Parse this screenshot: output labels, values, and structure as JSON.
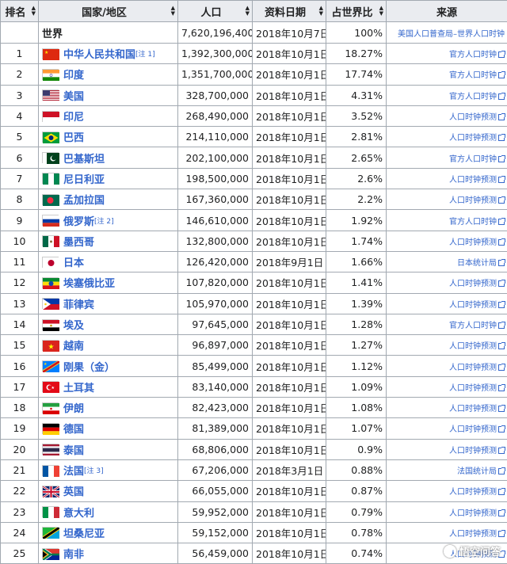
{
  "headers": {
    "rank": "排名",
    "country": "国家/地区",
    "population": "人口",
    "date": "资料日期",
    "share": "占世界比",
    "source": "来源"
  },
  "world": {
    "name": "世界",
    "population": "7,620,196,400",
    "date": "2018年10月7日",
    "share": "100%",
    "source": "美国人口普查局–世界人口时钟"
  },
  "rows": [
    {
      "rank": "1",
      "name": "中华人民共和国",
      "note": "[注 1]",
      "flag": "cn",
      "population": "1,392,300,000",
      "date": "2018年10月1日",
      "share": "18.27%",
      "source": "官方人口时钟"
    },
    {
      "rank": "2",
      "name": "印度",
      "note": "",
      "flag": "in",
      "population": "1,351,700,000",
      "date": "2018年10月1日",
      "share": "17.74%",
      "source": "官方人口时钟"
    },
    {
      "rank": "3",
      "name": "美国",
      "note": "",
      "flag": "us",
      "population": "328,700,000",
      "date": "2018年10月1日",
      "share": "4.31%",
      "source": "官方人口时钟"
    },
    {
      "rank": "4",
      "name": "印尼",
      "note": "",
      "flag": "id",
      "population": "268,490,000",
      "date": "2018年10月1日",
      "share": "3.52%",
      "source": "人口时钟预测"
    },
    {
      "rank": "5",
      "name": "巴西",
      "note": "",
      "flag": "br",
      "population": "214,110,000",
      "date": "2018年10月1日",
      "share": "2.81%",
      "source": "人口时钟预测"
    },
    {
      "rank": "6",
      "name": "巴基斯坦",
      "note": "",
      "flag": "pk",
      "population": "202,100,000",
      "date": "2018年10月1日",
      "share": "2.65%",
      "source": "官方人口时钟"
    },
    {
      "rank": "7",
      "name": "尼日利亚",
      "note": "",
      "flag": "ng",
      "population": "198,500,000",
      "date": "2018年10月1日",
      "share": "2.6%",
      "source": "人口时钟预测"
    },
    {
      "rank": "8",
      "name": "孟加拉国",
      "note": "",
      "flag": "bd",
      "population": "167,360,000",
      "date": "2018年10月1日",
      "share": "2.2%",
      "source": "人口时钟预测"
    },
    {
      "rank": "9",
      "name": "俄罗斯",
      "note": "[注 2]",
      "flag": "ru",
      "population": "146,610,000",
      "date": "2018年10月1日",
      "share": "1.92%",
      "source": "官方人口时钟"
    },
    {
      "rank": "10",
      "name": "墨西哥",
      "note": "",
      "flag": "mx",
      "population": "132,800,000",
      "date": "2018年10月1日",
      "share": "1.74%",
      "source": "人口时钟预测"
    },
    {
      "rank": "11",
      "name": "日本",
      "note": "",
      "flag": "jp",
      "population": "126,420,000",
      "date": "2018年9月1日",
      "share": "1.66%",
      "source": "日本统计局"
    },
    {
      "rank": "12",
      "name": "埃塞俄比亚",
      "note": "",
      "flag": "et",
      "population": "107,820,000",
      "date": "2018年10月1日",
      "share": "1.41%",
      "source": "人口时钟预测"
    },
    {
      "rank": "13",
      "name": "菲律宾",
      "note": "",
      "flag": "ph",
      "population": "105,970,000",
      "date": "2018年10月1日",
      "share": "1.39%",
      "source": "人口时钟预测"
    },
    {
      "rank": "14",
      "name": "埃及",
      "note": "",
      "flag": "eg",
      "population": "97,645,000",
      "date": "2018年10月1日",
      "share": "1.28%",
      "source": "官方人口时钟"
    },
    {
      "rank": "15",
      "name": "越南",
      "note": "",
      "flag": "vn",
      "population": "96,897,000",
      "date": "2018年10月1日",
      "share": "1.27%",
      "source": "人口时钟预测"
    },
    {
      "rank": "16",
      "name": "刚果（金）",
      "note": "",
      "flag": "cd",
      "population": "85,499,000",
      "date": "2018年10月1日",
      "share": "1.12%",
      "source": "人口时钟预测"
    },
    {
      "rank": "17",
      "name": "土耳其",
      "note": "",
      "flag": "tr",
      "population": "83,140,000",
      "date": "2018年10月1日",
      "share": "1.09%",
      "source": "人口时钟预测"
    },
    {
      "rank": "18",
      "name": "伊朗",
      "note": "",
      "flag": "ir",
      "population": "82,423,000",
      "date": "2018年10月1日",
      "share": "1.08%",
      "source": "人口时钟预测"
    },
    {
      "rank": "19",
      "name": "德国",
      "note": "",
      "flag": "de",
      "population": "81,389,000",
      "date": "2018年10月1日",
      "share": "1.07%",
      "source": "人口时钟预测"
    },
    {
      "rank": "20",
      "name": "泰国",
      "note": "",
      "flag": "th",
      "population": "68,806,000",
      "date": "2018年10月1日",
      "share": "0.9%",
      "source": "人口时钟预测"
    },
    {
      "rank": "21",
      "name": "法国",
      "note": "[注 3]",
      "flag": "fr",
      "population": "67,206,000",
      "date": "2018年3月1日",
      "share": "0.88%",
      "source": "法国统计局"
    },
    {
      "rank": "22",
      "name": "英国",
      "note": "",
      "flag": "gb",
      "population": "66,055,000",
      "date": "2018年10月1日",
      "share": "0.87%",
      "source": "人口时钟预测"
    },
    {
      "rank": "23",
      "name": "意大利",
      "note": "",
      "flag": "it",
      "population": "59,952,000",
      "date": "2018年10月1日",
      "share": "0.79%",
      "source": "人口时钟预测"
    },
    {
      "rank": "24",
      "name": "坦桑尼亚",
      "note": "",
      "flag": "tz",
      "population": "59,152,000",
      "date": "2018年10月1日",
      "share": "0.78%",
      "source": "人口时钟预测"
    },
    {
      "rank": "25",
      "name": "南非",
      "note": "",
      "flag": "za",
      "population": "56,459,000",
      "date": "2018年10月1日",
      "share": "0.74%",
      "source": "人口时钟预测"
    }
  ],
  "watermark": "悟空问答"
}
